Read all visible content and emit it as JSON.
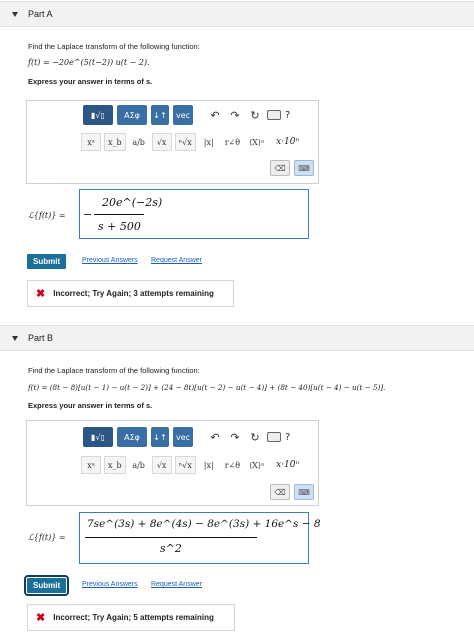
{
  "partA": {
    "title": "Part A",
    "instruction": "Find the Laplace transform of the following function:",
    "function": "f(t) = −20e^(5(t−2)) u(t − 2).",
    "express": "Express your answer in terms of s.",
    "lhs": "ℒ{f(t)} =",
    "answer": {
      "sign": "−",
      "numerator": "20e^(−2s)",
      "denominator": "s + 500"
    },
    "submit": "Submit",
    "previous": "Previous Answers",
    "request": "Request Answer",
    "feedback": "Incorrect; Try Again; 3 attempts remaining"
  },
  "partB": {
    "title": "Part B",
    "instruction": "Find the Laplace transform of the following function:",
    "function": "f(t) = (8t − 8)[u(t − 1) − u(t − 2)] + (24 − 8t)[u(t − 2) − u(t − 4)] + (8t − 40)[u(t − 4) − u(t − 5)].",
    "express": "Express your answer in terms of s.",
    "lhs": "ℒ{f(t)} =",
    "answer": {
      "numerator": "7se^(3s) + 8e^(4s) − 8e^(3s) + 16e^s − 8",
      "denominator": "s^2"
    },
    "submit": "Submit",
    "previous": "Previous Answers",
    "request": "Request Answer",
    "feedback": "Incorrect; Try Again; 5 attempts remaining"
  },
  "toolbar": {
    "templates": "▮√▯",
    "greek": "ΑΣφ",
    "arrows": "↓↑",
    "vec": "vec",
    "undo": "↶",
    "redo": "↷",
    "reset": "↻",
    "help": "?"
  },
  "symbols": [
    "xᵃ",
    "x_b",
    "a/b",
    "√x",
    "ⁿ√x",
    "|x|",
    "r∠θ",
    "⟨X⟩ᵃ"
  ],
  "symbol_tail": "x·10ⁿ",
  "keys": {
    "delete": "⌫",
    "keyboard": "⌨"
  }
}
